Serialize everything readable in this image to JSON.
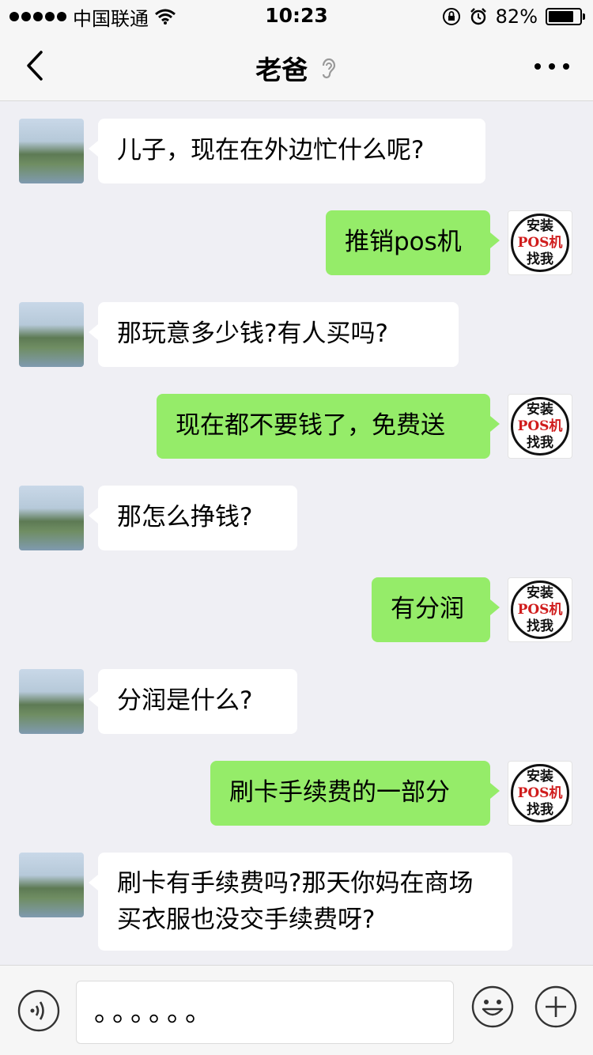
{
  "status_bar": {
    "carrier": "中国联通",
    "time": "10:23",
    "battery_percent": "82%",
    "battery_level": 0.82,
    "icons": [
      "signal-dots",
      "wifi-icon",
      "orientation-lock-icon",
      "alarm-icon",
      "battery-icon"
    ]
  },
  "nav": {
    "title": "老爸",
    "back_icon": "chevron-left-icon",
    "earpiece_icon": "ear-icon",
    "more_icon": "more-icon"
  },
  "messages": [
    {
      "side": "left",
      "text": "儿子，现在在外边忙什么呢?"
    },
    {
      "side": "right",
      "text": "推销pos机"
    },
    {
      "side": "left",
      "text": "那玩意多少钱?有人买吗?"
    },
    {
      "side": "right",
      "text": "现在都不要钱了，免费送"
    },
    {
      "side": "left",
      "text": "那怎么挣钱?"
    },
    {
      "side": "right",
      "text": "有分润"
    },
    {
      "side": "left",
      "text": "分润是什么?"
    },
    {
      "side": "right",
      "text": "刷卡手续费的一部分"
    },
    {
      "side": "left",
      "text": "刷卡有手续费吗?那天你妈在商场买衣服也没交手续费呀?"
    }
  ],
  "self_avatar": {
    "line1": "安装",
    "line2": "POS机",
    "line3": "找我"
  },
  "input_bar": {
    "value": "。。。。。。",
    "voice_icon": "voice-icon",
    "emoji_icon": "emoji-icon",
    "plus_icon": "plus-icon"
  },
  "colors": {
    "self_bubble": "#95ec69",
    "other_bubble": "#ffffff",
    "background": "#efeff4",
    "pos_red": "#d01c1c"
  }
}
